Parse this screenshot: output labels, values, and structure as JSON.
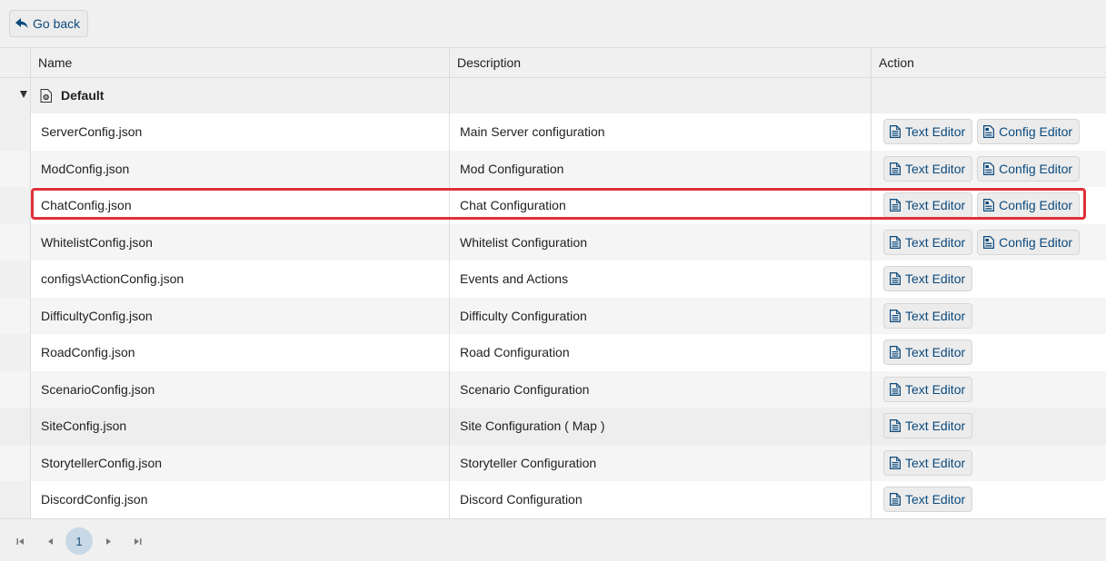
{
  "toolbar": {
    "go_back_label": "Go back"
  },
  "table": {
    "columns": {
      "name": "Name",
      "description": "Description",
      "action": "Action"
    },
    "group": {
      "label": "Default"
    },
    "rows": [
      {
        "name": "ServerConfig.json",
        "description": "Main Server configuration",
        "text_editor": "Text Editor",
        "config_editor": "Config Editor"
      },
      {
        "name": "ModConfig.json",
        "description": "Mod Configuration",
        "text_editor": "Text Editor",
        "config_editor": "Config Editor"
      },
      {
        "name": "ChatConfig.json",
        "description": "Chat Configuration",
        "text_editor": "Text Editor",
        "config_editor": "Config Editor"
      },
      {
        "name": "WhitelistConfig.json",
        "description": "Whitelist Configuration",
        "text_editor": "Text Editor",
        "config_editor": "Config Editor"
      },
      {
        "name": "configs\\ActionConfig.json",
        "description": "Events and Actions",
        "text_editor": "Text Editor"
      },
      {
        "name": "DifficultyConfig.json",
        "description": "Difficulty Configuration",
        "text_editor": "Text Editor"
      },
      {
        "name": "RoadConfig.json",
        "description": "Road Configuration",
        "text_editor": "Text Editor"
      },
      {
        "name": "ScenarioConfig.json",
        "description": "Scenario Configuration",
        "text_editor": "Text Editor"
      },
      {
        "name": "SiteConfig.json",
        "description": "Site Configuration ( Map )",
        "text_editor": "Text Editor"
      },
      {
        "name": "StorytellerConfig.json",
        "description": "Storyteller Configuration",
        "text_editor": "Text Editor"
      },
      {
        "name": "DiscordConfig.json",
        "description": "Discord Configuration",
        "text_editor": "Text Editor"
      }
    ]
  },
  "pagination": {
    "current_page": "1"
  },
  "colors": {
    "accent": "#0c4a7d",
    "highlight": "#e0313b",
    "page_active": "#c8d8e6"
  },
  "icons": {
    "back": "reply-arrow-icon",
    "text_editor": "file-text-icon",
    "config_editor": "file-config-icon",
    "group": "file-gear-icon"
  }
}
